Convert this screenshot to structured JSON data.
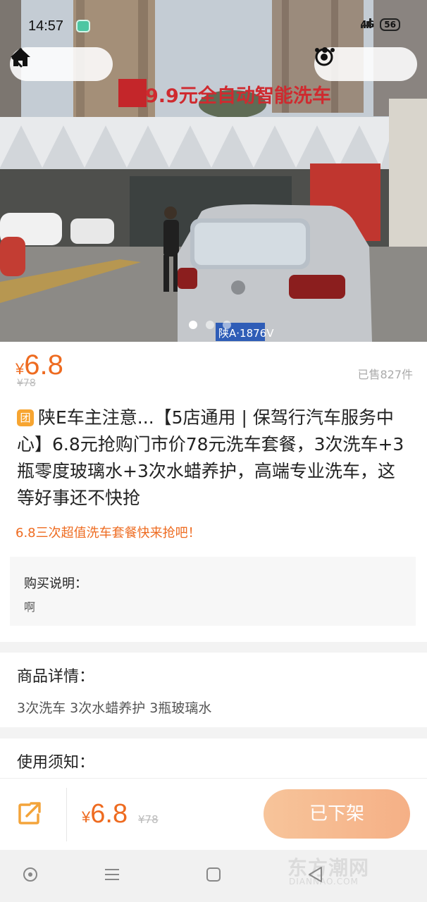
{
  "status_bar": {
    "time": "14:57",
    "network": "4G",
    "battery": "56"
  },
  "nav": {
    "back_icon": "chevron-left-icon",
    "home_icon": "home-icon",
    "more_icon": "more-dots-icon",
    "close_icon": "target-circle-icon"
  },
  "hero": {
    "sign_text": "9.9元全自动智能洗车",
    "plate_text": "陕A·1876V",
    "carousel_total": 3,
    "carousel_active": 1
  },
  "product": {
    "currency": "¥",
    "price": "6.8",
    "original_price": "¥78",
    "sold": "已售827件",
    "badge": "团",
    "title": "陕E车主注意...【5店通用 | 保驾行汽车服务中心】6.8元抢购门市价78元洗车套餐，3次洗车+3瓶零度玻璃水+3次水蜡养护，高端专业洗车，这等好事还不快抢",
    "subtitle": "6.8三次超值洗车套餐快来抢吧！"
  },
  "purchase": {
    "label": "购买说明：",
    "text": "啊"
  },
  "details": {
    "label": "商品详情：",
    "text": "3次洗车 3次水蜡养护 3瓶玻璃水"
  },
  "notice": {
    "label": "使用须知："
  },
  "bottom_bar": {
    "share_icon": "share-icon",
    "currency": "¥",
    "price": "6.8",
    "original_price": "¥78",
    "button_label": "已下架"
  },
  "watermark": {
    "text": "东方潮网",
    "sub": "DIANNAO.COM"
  },
  "colors": {
    "accent": "#ee6b20",
    "button": "#f5b086",
    "badge": "#f7a531"
  }
}
